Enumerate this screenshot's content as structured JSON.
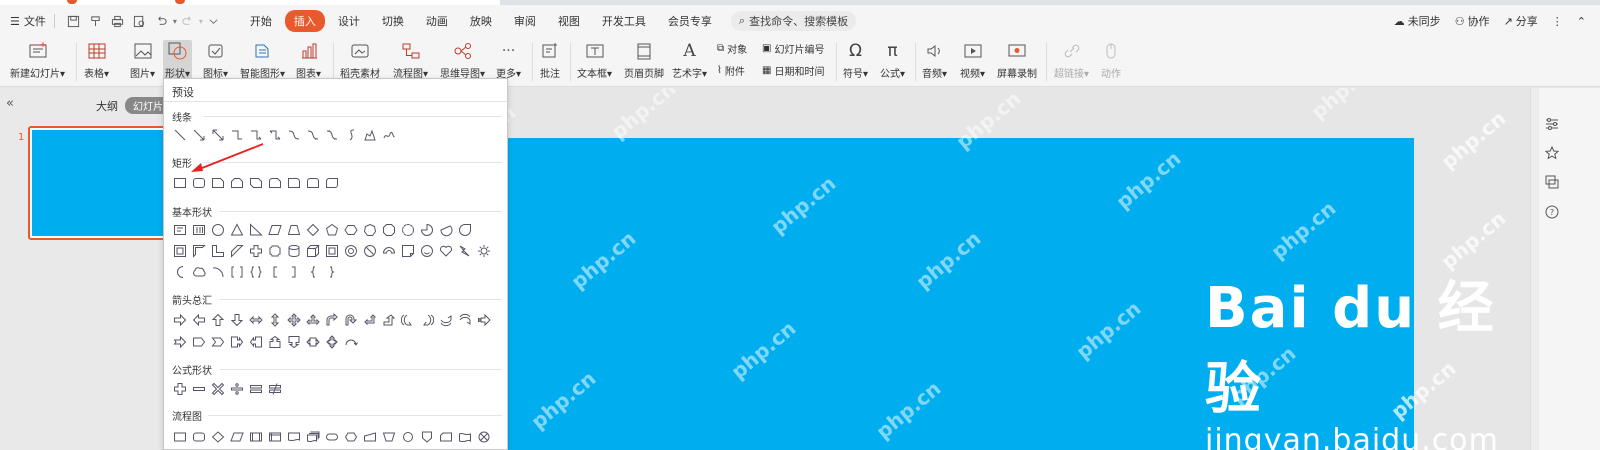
{
  "menubar": {
    "file_label": "文件",
    "tabs": [
      "开始",
      "插入",
      "设计",
      "切换",
      "动画",
      "放映",
      "审阅",
      "视图",
      "开发工具",
      "会员专享"
    ],
    "active_tab": "插入",
    "search_label": "查找命令、搜索模板",
    "not_synced": "未同步",
    "collaborate": "协作",
    "share": "分享"
  },
  "ribbon": {
    "new_slide": "新建幻灯片",
    "table": "表格",
    "picture": "图片",
    "shape": "形状",
    "icon": "图标",
    "smart_graphic": "智能图形",
    "chart": "图表",
    "material": "稻壳素材",
    "flowchart": "流程图",
    "mindmap": "思维导图",
    "more": "更多",
    "comment": "批注",
    "textbox": "文本框",
    "header_footer": "页眉页脚",
    "wordart": "艺术字",
    "object": "对象",
    "attachment": "附件",
    "slide_number": "幻灯片编号",
    "datetime": "日期和时间",
    "symbol": "符号",
    "formula": "公式",
    "audio": "音频",
    "video": "视频",
    "screen_record": "屏幕录制",
    "hyperlink": "超链接",
    "action": "动作"
  },
  "left_panel": {
    "outline": "大纲",
    "slides_tab": "幻灯片",
    "slide_number": "1"
  },
  "shapes_menu": {
    "title": "预设",
    "sections": [
      "线条",
      "矩形",
      "基本形状",
      "箭头总汇",
      "公式形状",
      "流程图"
    ]
  },
  "watermarks": {
    "site": "php.cn",
    "baidu_logo": "Bai du 经验",
    "baidu_url": "jingyan.baidu.com"
  },
  "colors": {
    "accent": "#e85a2c",
    "slide_fill": "#00aeef",
    "annotation_arrow": "#e8201f"
  }
}
